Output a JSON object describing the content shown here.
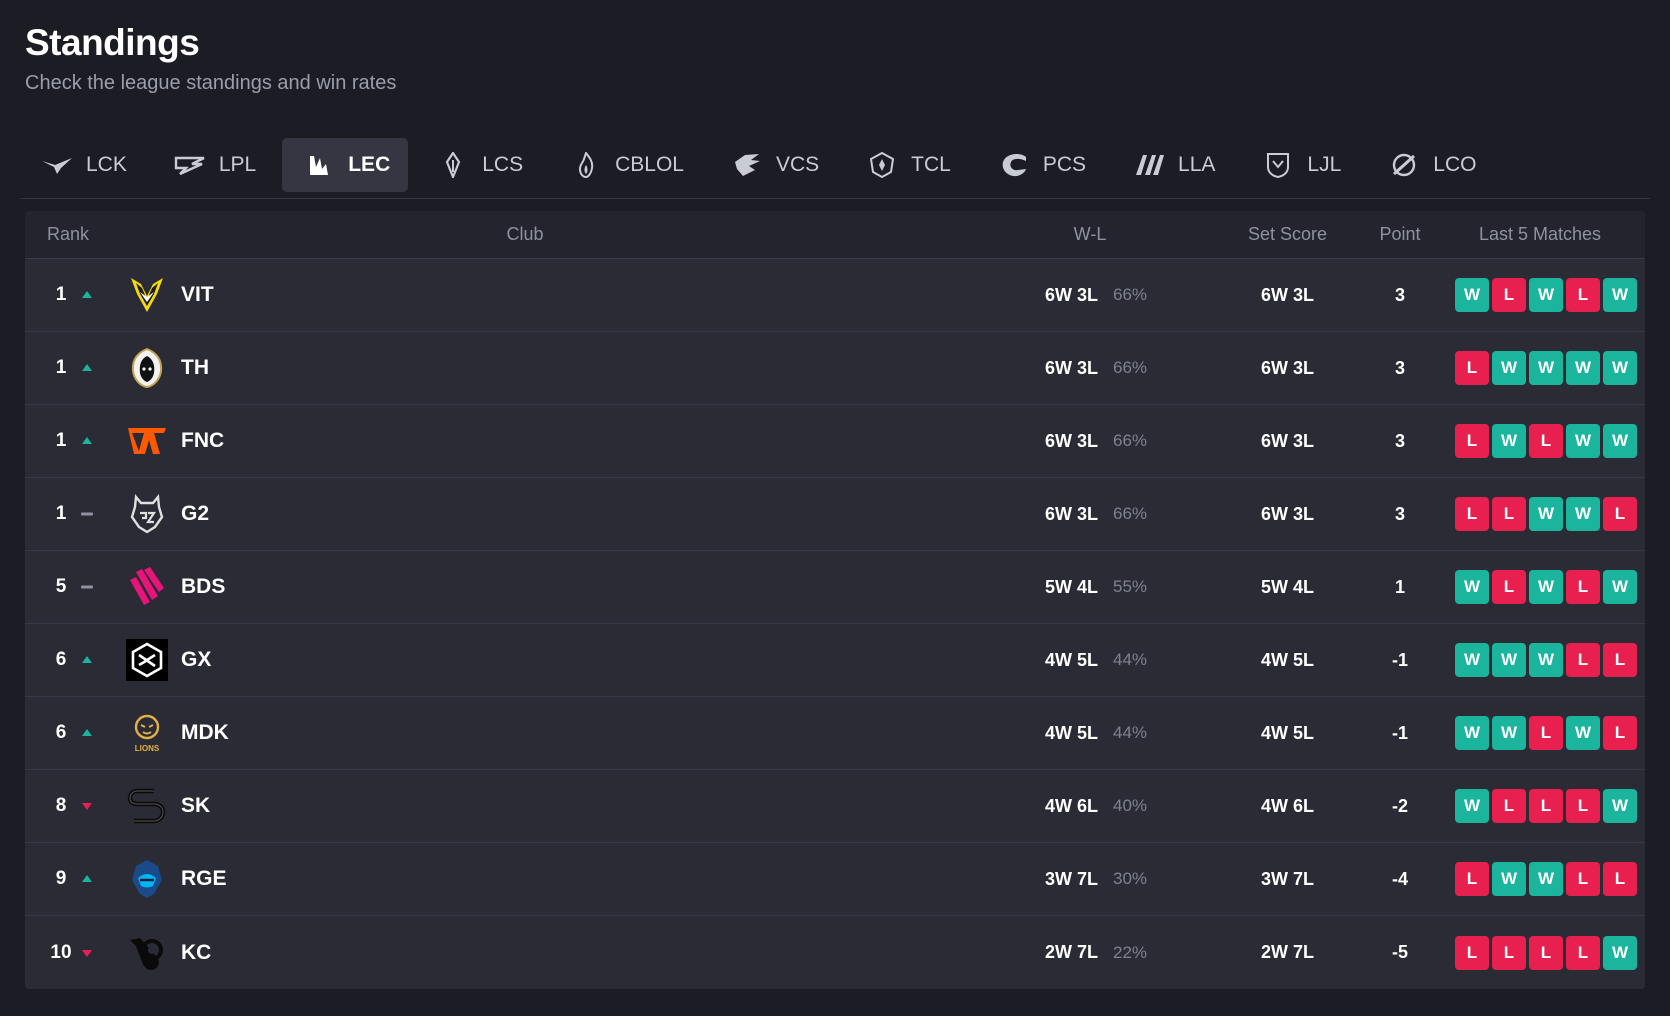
{
  "header": {
    "title": "Standings",
    "subtitle": "Check the league standings and win rates"
  },
  "colors": {
    "win": "#1bb49d",
    "loss": "#e8204f",
    "up": "#1bb49d",
    "down": "#e8204f",
    "same": "#8e92a0"
  },
  "tabs": [
    {
      "label": "LCK",
      "icon": "lck-icon",
      "active": false
    },
    {
      "label": "LPL",
      "icon": "lpl-icon",
      "active": false
    },
    {
      "label": "LEC",
      "icon": "lec-icon",
      "active": true
    },
    {
      "label": "LCS",
      "icon": "lcs-icon",
      "active": false
    },
    {
      "label": "CBLOL",
      "icon": "cblol-icon",
      "active": false
    },
    {
      "label": "VCS",
      "icon": "vcs-icon",
      "active": false
    },
    {
      "label": "TCL",
      "icon": "tcl-icon",
      "active": false
    },
    {
      "label": "PCS",
      "icon": "pcs-icon",
      "active": false
    },
    {
      "label": "LLA",
      "icon": "lla-icon",
      "active": false
    },
    {
      "label": "LJL",
      "icon": "ljl-icon",
      "active": false
    },
    {
      "label": "LCO",
      "icon": "lco-icon",
      "active": false
    }
  ],
  "table": {
    "headers": {
      "rank": "Rank",
      "club": "Club",
      "wl": "W-L",
      "set_score": "Set Score",
      "point": "Point",
      "last5": "Last 5 Matches"
    },
    "rows": [
      {
        "rank": "1",
        "trend": "up",
        "team": "VIT",
        "logo": "vitality-logo",
        "wl": "6W 3L",
        "pct": "66%",
        "set": "6W 3L",
        "point": "3",
        "last5": [
          "W",
          "L",
          "W",
          "L",
          "W"
        ]
      },
      {
        "rank": "1",
        "trend": "up",
        "team": "TH",
        "logo": "heretics-logo",
        "wl": "6W 3L",
        "pct": "66%",
        "set": "6W 3L",
        "point": "3",
        "last5": [
          "L",
          "W",
          "W",
          "W",
          "W"
        ]
      },
      {
        "rank": "1",
        "trend": "up",
        "team": "FNC",
        "logo": "fnatic-logo",
        "wl": "6W 3L",
        "pct": "66%",
        "set": "6W 3L",
        "point": "3",
        "last5": [
          "L",
          "W",
          "L",
          "W",
          "W"
        ]
      },
      {
        "rank": "1",
        "trend": "same",
        "team": "G2",
        "logo": "g2-logo",
        "wl": "6W 3L",
        "pct": "66%",
        "set": "6W 3L",
        "point": "3",
        "last5": [
          "L",
          "L",
          "W",
          "W",
          "L"
        ]
      },
      {
        "rank": "5",
        "trend": "same",
        "team": "BDS",
        "logo": "bds-logo",
        "wl": "5W 4L",
        "pct": "55%",
        "set": "5W 4L",
        "point": "1",
        "last5": [
          "W",
          "L",
          "W",
          "L",
          "W"
        ]
      },
      {
        "rank": "6",
        "trend": "up",
        "team": "GX",
        "logo": "giantx-logo",
        "wl": "4W 5L",
        "pct": "44%",
        "set": "4W 5L",
        "point": "-1",
        "last5": [
          "W",
          "W",
          "W",
          "L",
          "L"
        ]
      },
      {
        "rank": "6",
        "trend": "up",
        "team": "MDK",
        "logo": "mad-lions-logo",
        "wl": "4W 5L",
        "pct": "44%",
        "set": "4W 5L",
        "point": "-1",
        "last5": [
          "W",
          "W",
          "L",
          "W",
          "L"
        ]
      },
      {
        "rank": "8",
        "trend": "down",
        "team": "SK",
        "logo": "sk-logo",
        "wl": "4W 6L",
        "pct": "40%",
        "set": "4W 6L",
        "point": "-2",
        "last5": [
          "W",
          "L",
          "L",
          "L",
          "W"
        ]
      },
      {
        "rank": "9",
        "trend": "up",
        "team": "RGE",
        "logo": "rogue-logo",
        "wl": "3W 7L",
        "pct": "30%",
        "set": "3W 7L",
        "point": "-4",
        "last5": [
          "L",
          "W",
          "W",
          "L",
          "L"
        ]
      },
      {
        "rank": "10",
        "trend": "down",
        "team": "KC",
        "logo": "karmine-logo",
        "wl": "2W 7L",
        "pct": "22%",
        "set": "2W 7L",
        "point": "-5",
        "last5": [
          "L",
          "L",
          "L",
          "L",
          "W"
        ]
      }
    ]
  }
}
